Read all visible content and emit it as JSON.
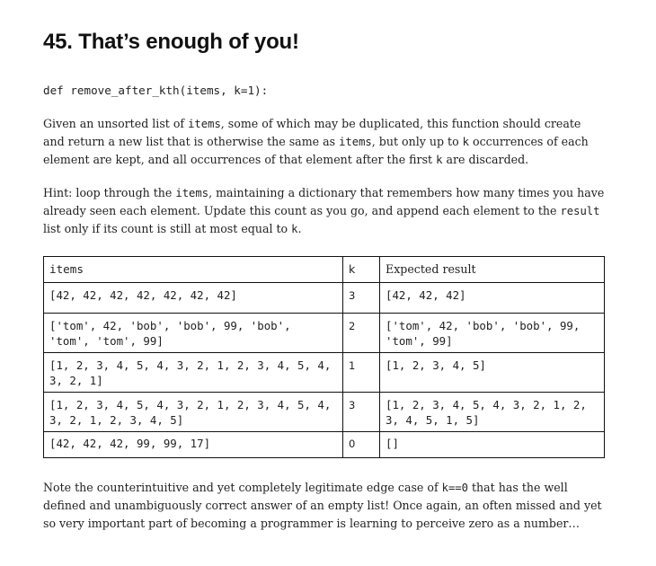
{
  "heading": "45. That’s enough of you!",
  "signature": "def remove_after_kth(items, k=1):",
  "paragraph1": {
    "t1": "Given an unsorted list of ",
    "c1": "items",
    "t2": ", some of which may be duplicated, this function should create and return a new list that is otherwise the same as ",
    "c2": "items",
    "t3": ", but only up to ",
    "c3": "k",
    "t4": " occurrences of each element are kept, and all occurrences of that element after the first ",
    "c4": "k",
    "t5": " are discarded."
  },
  "paragraph2": {
    "t1": "Hint: loop through the ",
    "c1": "items",
    "t2": ", maintaining a dictionary that remembers how many times you have already seen each element. Update this count as you go, and append each element to the ",
    "c2": "result",
    "t3": " list only if its count is still at most equal to ",
    "c3": "k",
    "t4": "."
  },
  "table": {
    "headers": {
      "items": "items",
      "k": "k",
      "expected": "Expected result"
    },
    "rows": [
      {
        "items": "[42, 42, 42, 42, 42, 42, 42]",
        "k": "3",
        "expected": "[42, 42, 42]"
      },
      {
        "items": "['tom', 42, 'bob', 'bob', 99, 'bob', 'tom', 'tom', 99]",
        "k": "2",
        "expected": "['tom', 42, 'bob', 'bob', 99, 'tom', 99]"
      },
      {
        "items": "[1, 2, 3, 4, 5, 4, 3, 2, 1, 2, 3, 4, 5, 4, 3, 2, 1]",
        "k": "1",
        "expected": "[1, 2, 3, 4, 5]"
      },
      {
        "items": "[1, 2, 3, 4, 5, 4, 3, 2, 1, 2, 3, 4, 5, 4, 3, 2, 1, 2, 3, 4, 5]",
        "k": "3",
        "expected": "[1, 2, 3, 4, 5, 4, 3, 2, 1, 2, 3, 4, 5, 1, 5]"
      },
      {
        "items": "[42, 42, 42, 99, 99, 17]",
        "k": "0",
        "expected": "[]"
      }
    ]
  },
  "paragraph3": {
    "t1": "Note the counterintuitive and yet completely legitimate edge case of ",
    "c1": "k==0",
    "t2": " that has the well defined and unambiguously correct answer of an empty list! Once again, an often missed and yet so very important part of becoming a programmer is learning to perceive zero as a number…"
  }
}
